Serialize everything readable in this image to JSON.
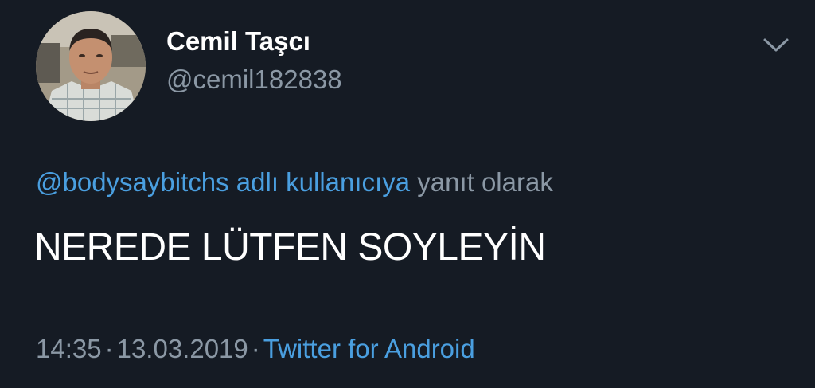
{
  "author": {
    "display_name": "Cemil Taşcı",
    "handle": "@cemil182838"
  },
  "reply": {
    "mention": "@bodysaybitchs adlı kullanıcıya",
    "suffix": " yanıt olarak"
  },
  "tweet": {
    "text": "NEREDE LÜTFEN SOYLEYİN"
  },
  "meta": {
    "time": "14:35",
    "separator": "·",
    "date": "13.03.2019",
    "source": "Twitter for Android"
  },
  "icons": {
    "menu": "chevron-down-icon",
    "avatar": "avatar"
  },
  "colors": {
    "background": "#151b24",
    "link": "#4a9fe0",
    "muted": "#8b98a5",
    "text": "#ffffff"
  }
}
